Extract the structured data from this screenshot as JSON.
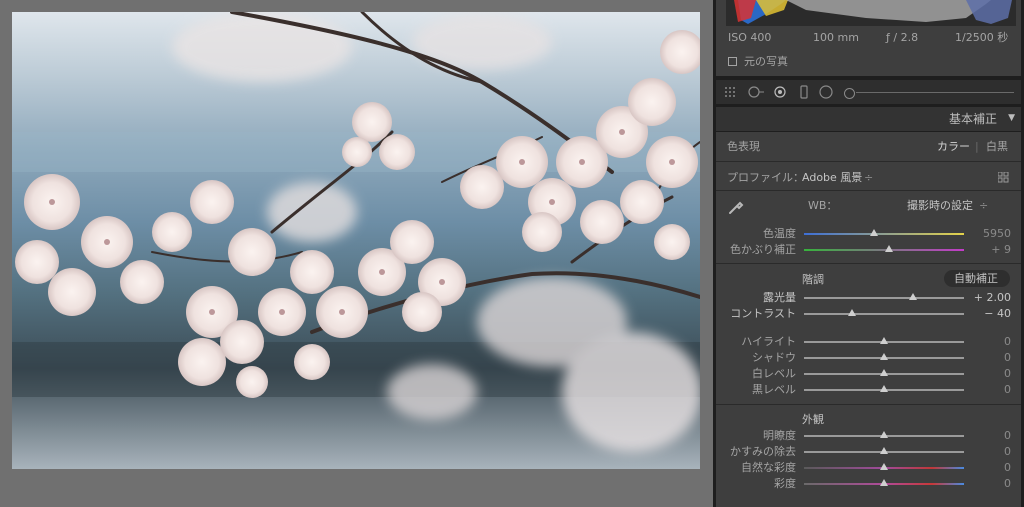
{
  "camera_info": {
    "iso": "ISO 400",
    "focal": "100 mm",
    "aperture": "ƒ / 2.8",
    "shutter": "1/2500 秒"
  },
  "original_photo_label": "元の写真",
  "panel_header": "基本補正",
  "color_treatment": {
    "label": "色表現",
    "color": "カラー",
    "bw": "白黒"
  },
  "profile": {
    "label": "プロファイル：",
    "value": "Adobe 風景"
  },
  "wb": {
    "label": "WB：",
    "value": "撮影時の設定"
  },
  "temp": {
    "label": "色温度",
    "value": "5950",
    "level": 0.44
  },
  "tint": {
    "label": "色かぶり補正",
    "value": "+ 9",
    "level": 0.53
  },
  "tone": {
    "title": "階調",
    "auto": "自動補正"
  },
  "exposure": {
    "label": "露光量",
    "value": "+ 2.00",
    "level": 0.68
  },
  "contrast": {
    "label": "コントラスト",
    "value": "− 40",
    "level": 0.3
  },
  "highlights": {
    "label": "ハイライト",
    "value": "0",
    "level": 0.5
  },
  "shadows": {
    "label": "シャドウ",
    "value": "0",
    "level": 0.5
  },
  "whites": {
    "label": "白レベル",
    "value": "0",
    "level": 0.5
  },
  "blacks": {
    "label": "黒レベル",
    "value": "0",
    "level": 0.5
  },
  "presence_title": "外観",
  "clarity": {
    "label": "明瞭度",
    "value": "0",
    "level": 0.5
  },
  "dehaze": {
    "label": "かすみの除去",
    "value": "0",
    "level": 0.5
  },
  "vibrance": {
    "label": "自然な彩度",
    "value": "0",
    "level": 0.5
  },
  "saturation": {
    "label": "彩度",
    "value": "0",
    "level": 0.5
  }
}
